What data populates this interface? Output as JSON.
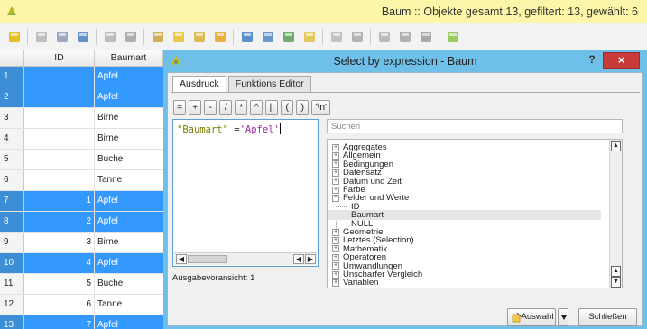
{
  "window": {
    "title": "Baum :: Objekte gesamt:13, gefiltert: 13, gewählt: 6"
  },
  "toolbar": {
    "buttons": [
      {
        "name": "toggle-editing-icon",
        "color": "#e0b600"
      },
      {
        "name": "edit-icon",
        "color": "#b5b5b5"
      },
      {
        "name": "save-edits-icon",
        "color": "#8a9bb0"
      },
      {
        "name": "reload-icon",
        "color": "#4a7fc1"
      },
      {
        "name": "add-feature-icon",
        "color": "#b0b0b0"
      },
      {
        "name": "delete-feature-icon",
        "color": "#a0a0a0"
      },
      {
        "name": "select-expression-icon",
        "color": "#c9a33b"
      },
      {
        "name": "select-all-icon",
        "color": "#e5c12b"
      },
      {
        "name": "invert-selection-icon",
        "color": "#d7b23a"
      },
      {
        "name": "deselect-icon",
        "color": "#e6a21f"
      },
      {
        "name": "filter-icon",
        "color": "#3c7fc2"
      },
      {
        "name": "move-selection-top-icon",
        "color": "#4f8ac6"
      },
      {
        "name": "pan-to-selected-icon",
        "color": "#5aa056"
      },
      {
        "name": "zoom-to-selected-icon",
        "color": "#e0c040"
      },
      {
        "name": "copy-icon",
        "color": "#b8b8b8"
      },
      {
        "name": "paste-icon",
        "color": "#a8a8a8"
      },
      {
        "name": "new-field-icon",
        "color": "#b0b0b0"
      },
      {
        "name": "delete-field-icon",
        "color": "#a5a5a5"
      },
      {
        "name": "field-calculator-icon",
        "color": "#9a9a9a"
      },
      {
        "name": "conditional-format-icon",
        "color": "#8bc34a"
      }
    ]
  },
  "table": {
    "headers": {
      "id": "ID",
      "baumart": "Baumart"
    },
    "rows": [
      {
        "num": "1",
        "id": "",
        "baumart": "Apfel",
        "selected": true
      },
      {
        "num": "2",
        "id": "",
        "baumart": "Apfel",
        "selected": true
      },
      {
        "num": "3",
        "id": "",
        "baumart": "Birne",
        "selected": false
      },
      {
        "num": "4",
        "id": "",
        "baumart": "Birne",
        "selected": false
      },
      {
        "num": "5",
        "id": "",
        "baumart": "Buche",
        "selected": false
      },
      {
        "num": "6",
        "id": "",
        "baumart": "Tanne",
        "selected": false
      },
      {
        "num": "7",
        "id": "1",
        "baumart": "Apfel",
        "selected": true
      },
      {
        "num": "8",
        "id": "2",
        "baumart": "Apfel",
        "selected": true
      },
      {
        "num": "9",
        "id": "3",
        "baumart": "Birne",
        "selected": false
      },
      {
        "num": "10",
        "id": "4",
        "baumart": "Apfel",
        "selected": true
      },
      {
        "num": "11",
        "id": "5",
        "baumart": "Buche",
        "selected": false
      },
      {
        "num": "12",
        "id": "6",
        "baumart": "Tanne",
        "selected": false
      },
      {
        "num": "13",
        "id": "7",
        "baumart": "Apfel",
        "selected": true
      }
    ]
  },
  "dialog": {
    "title": "Select by expression - Baum",
    "help_label": "?",
    "close_label": "×",
    "tabs": [
      "Ausdruck",
      "Funktions Editor"
    ],
    "operators": [
      "=",
      "+",
      "-",
      "/",
      "*",
      "^",
      "||",
      "(",
      ")",
      "'\\n'"
    ],
    "expression": {
      "field": "\"Baumart\"",
      "op": " =",
      "value": "'Apfel'"
    },
    "preview": "Ausgabevoransicht: 1",
    "search_placeholder": "Suchen",
    "tree": [
      {
        "label": "Aggregates",
        "type": "group",
        "expanded": false
      },
      {
        "label": "Allgemein",
        "type": "group",
        "expanded": false
      },
      {
        "label": "Bedingungen",
        "type": "group",
        "expanded": false
      },
      {
        "label": "Datensatz",
        "type": "group",
        "expanded": false
      },
      {
        "label": "Datum und Zeit",
        "type": "group",
        "expanded": false
      },
      {
        "label": "Farbe",
        "type": "group",
        "expanded": false
      },
      {
        "label": "Felder und Werte",
        "type": "group",
        "expanded": true
      },
      {
        "label": "ID",
        "type": "child"
      },
      {
        "label": "Baumart",
        "type": "child",
        "selected": true
      },
      {
        "label": "NULL",
        "type": "child"
      },
      {
        "label": "Geometrie",
        "type": "group",
        "expanded": false
      },
      {
        "label": "Letztes (Selection)",
        "type": "group",
        "expanded": false
      },
      {
        "label": "Mathematik",
        "type": "group",
        "expanded": false
      },
      {
        "label": "Operatoren",
        "type": "group",
        "expanded": false
      },
      {
        "label": "Umwandlungen",
        "type": "group",
        "expanded": false
      },
      {
        "label": "Unscharfer Vergleich",
        "type": "group",
        "expanded": false
      },
      {
        "label": "Variablen",
        "type": "group",
        "expanded": false
      }
    ],
    "buttons": {
      "select": "Auswahl",
      "close": "Schließen"
    }
  }
}
